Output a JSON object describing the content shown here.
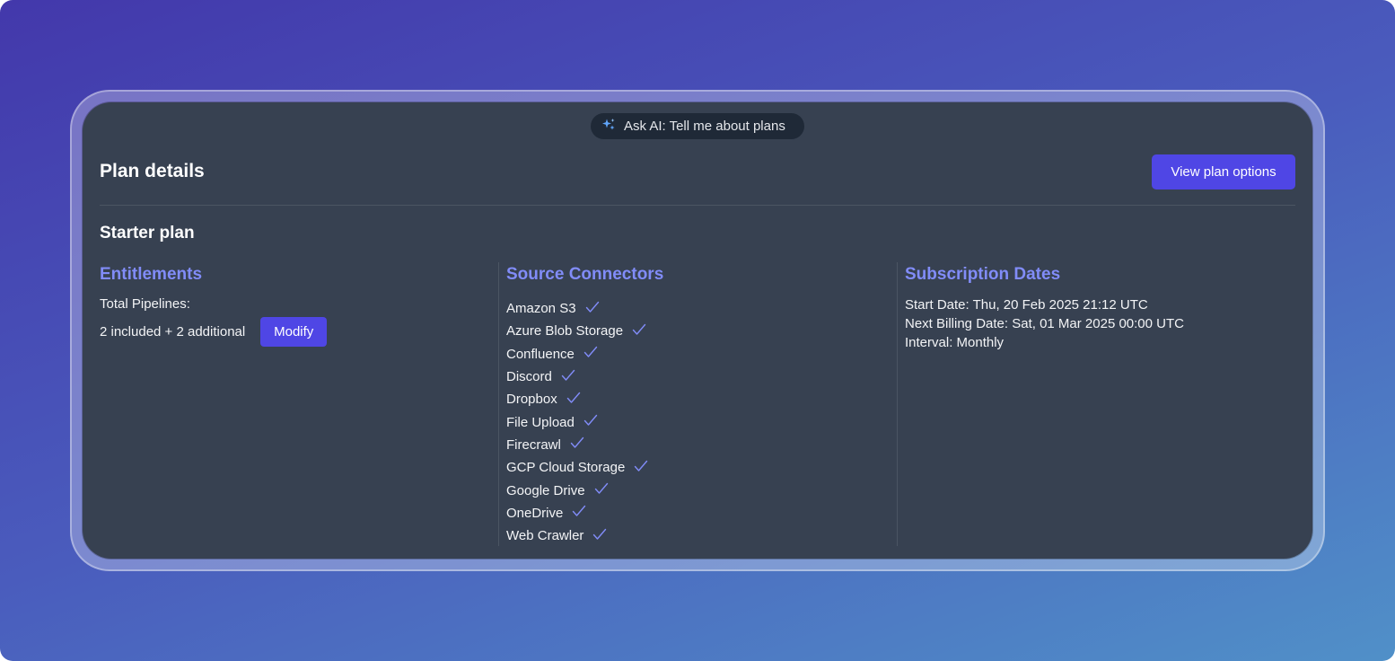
{
  "ask_ai": {
    "label": "Ask AI: Tell me about plans",
    "icon": "sparkles-icon"
  },
  "header": {
    "title": "Plan details",
    "view_options_label": "View plan options"
  },
  "plan": {
    "name": "Starter plan"
  },
  "entitlements": {
    "heading": "Entitlements",
    "pipelines_label": "Total Pipelines:",
    "pipelines_value": "2 included + 2 additional",
    "modify_label": "Modify"
  },
  "connectors": {
    "heading": "Source Connectors",
    "items": [
      "Amazon S3",
      "Azure Blob Storage",
      "Confluence",
      "Discord",
      "Dropbox",
      "File Upload",
      "Firecrawl",
      "GCP Cloud Storage",
      "Google Drive",
      "OneDrive",
      "Web Crawler"
    ]
  },
  "subscription": {
    "heading": "Subscription Dates",
    "start_date": "Start Date: Thu, 20 Feb 2025 21:12 UTC",
    "next_billing": "Next Billing Date: Sat, 01 Mar 2025 00:00 UTC",
    "interval": "Interval: Monthly"
  },
  "colors": {
    "accent": "#4f46e5",
    "heading_accent": "#818cf8",
    "card_bg": "#374151"
  }
}
